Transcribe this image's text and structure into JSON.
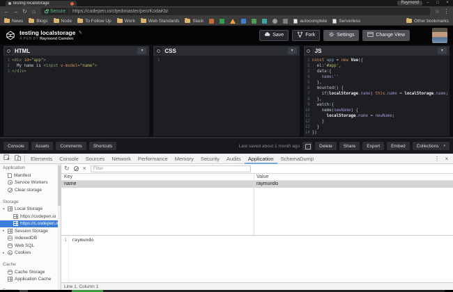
{
  "glyphs": {
    "back": "←",
    "forward": "→",
    "reload": "↻",
    "home": "⌂",
    "star": "☆",
    "kebab": "⋮",
    "minimize": "–",
    "restore": "□",
    "close": "×",
    "pencil": "✎",
    "chevron_down": "▾",
    "refresh": "↻",
    "clear_x": "×",
    "dt_kebab": "⋮",
    "dt_close": "×"
  },
  "browser": {
    "tab_title": "testing localstorage",
    "profile_name": "Raymond",
    "address": {
      "secure_label": "Secure",
      "url": "https://codepen.io/cfjedimaster/pen/KodaKb/"
    },
    "bookmarks": [
      {
        "label": "News",
        "icon": "folder"
      },
      {
        "label": "Blogs",
        "icon": "folder"
      },
      {
        "label": "Node",
        "icon": "folder"
      },
      {
        "label": "To Follow Up",
        "icon": "folder"
      },
      {
        "label": "Work",
        "icon": "folder"
      },
      {
        "label": "Web Standards",
        "icon": "folder"
      },
      {
        "label": "Slack",
        "icon": "folder"
      },
      {
        "icon": "favicon",
        "color": "#c96a38"
      },
      {
        "icon": "favicon",
        "color": "#2e9e4f"
      },
      {
        "icon": "favicon-triangle",
        "color": "#f2a33c"
      },
      {
        "icon": "favicon",
        "color": "#3f7fd4"
      },
      {
        "icon": "favicon",
        "color": "#4b9e57"
      },
      {
        "icon": "favicon",
        "color": "#3aa6a0"
      },
      {
        "icon": "favicon-circle",
        "color": "#9a9a9a"
      },
      {
        "icon": "favicon",
        "color": "#7d7d7d"
      },
      {
        "label": "autocomplete",
        "icon": "page"
      },
      {
        "label": "Serverless",
        "icon": "page"
      }
    ],
    "other_bookmarks_label": "Other bookmarks"
  },
  "pen": {
    "title": "testing localstorage",
    "byline": "A PEN BY",
    "author": "Raymond Camden",
    "buttons": [
      {
        "icon": "cloud",
        "label": "Save"
      },
      {
        "icon": "fork",
        "label": "Fork"
      },
      {
        "icon": "gear",
        "label": "Settings"
      },
      {
        "icon": "layout",
        "label": "Change View"
      }
    ]
  },
  "editors": [
    {
      "label": "HTML",
      "lines": [
        [
          [
            "t",
            "<div "
          ],
          [
            "k",
            "id="
          ],
          [
            "s",
            "\"app\""
          ],
          [
            "t",
            ">"
          ]
        ],
        [
          [
            "p",
            "  My name is "
          ],
          [
            "t",
            "<input "
          ],
          [
            "k",
            "v-model="
          ],
          [
            "s",
            "\"name\""
          ],
          [
            "t",
            ">"
          ]
        ],
        [
          [
            "t",
            "</div>"
          ]
        ]
      ]
    },
    {
      "label": "CSS",
      "lines": [
        []
      ]
    },
    {
      "label": "JS",
      "lines": [
        [
          [
            "k",
            "const "
          ],
          [
            "v",
            "app "
          ],
          [
            "p",
            "= "
          ],
          [
            "k",
            "new "
          ],
          [
            "b",
            "Vue"
          ],
          [
            "p",
            "({"
          ]
        ],
        [
          [
            "p",
            "  el:"
          ],
          [
            "s",
            "'#app'"
          ],
          [
            "p",
            ","
          ]
        ],
        [
          [
            "p",
            "  data:{"
          ]
        ],
        [
          [
            "p",
            "    "
          ],
          [
            "n",
            "name"
          ],
          [
            "p",
            ":"
          ],
          [
            "s",
            "''"
          ]
        ],
        [
          [
            "p",
            "  },"
          ]
        ],
        [
          [
            "p",
            "  mounted() {"
          ]
        ],
        [
          [
            "p",
            "    if("
          ],
          [
            "b",
            "localStorage"
          ],
          [
            "n",
            ".name"
          ],
          [
            "p",
            ") "
          ],
          [
            "k",
            "this"
          ],
          [
            "n",
            ".name"
          ],
          [
            "p",
            " = "
          ],
          [
            "b",
            "localStorage"
          ],
          [
            "n",
            ".name"
          ],
          [
            "p",
            ";"
          ]
        ],
        [
          [
            "p",
            "  },"
          ]
        ],
        [
          [
            "p",
            "  watch:{"
          ]
        ],
        [
          [
            "p",
            "    name("
          ],
          [
            "n",
            "newName"
          ],
          [
            "p",
            ") {"
          ]
        ],
        [
          [
            "p",
            "      "
          ],
          [
            "b",
            "localStorage"
          ],
          [
            "n",
            ".name"
          ],
          [
            "p",
            " = "
          ],
          [
            "n",
            "newName"
          ],
          [
            "p",
            ";"
          ]
        ],
        [
          [
            "p",
            "    }"
          ]
        ],
        [
          [
            "p",
            "  }"
          ]
        ],
        [
          [
            "p",
            "})"
          ]
        ]
      ]
    }
  ],
  "pen_footer": {
    "left_buttons": [
      "Console",
      "Assets",
      "Comments",
      "Shortcuts"
    ],
    "saved_text": "Last saved about 1 month ago",
    "right_buttons": [
      "Delete",
      "Share",
      "Export",
      "Embed"
    ],
    "collections_label": "Collections"
  },
  "devtools": {
    "tabs": [
      "Elements",
      "Console",
      "Sources",
      "Network",
      "Performance",
      "Memory",
      "Security",
      "Audits",
      "Application",
      "SchemaDump"
    ],
    "active_tab": "Application",
    "sidebar": {
      "sections": [
        {
          "title": "Application",
          "items": [
            {
              "label": "Manifest",
              "icon": "page"
            },
            {
              "label": "Service Workers",
              "icon": "gear"
            },
            {
              "label": "Clear storage",
              "icon": "clear"
            }
          ]
        },
        {
          "title": "Storage",
          "items": [
            {
              "label": "Local Storage",
              "icon": "grid",
              "arrow": "▾"
            },
            {
              "label": "https://codepen.io",
              "icon": "grid",
              "child": true
            },
            {
              "label": "https://s.codepen.io",
              "icon": "grid",
              "child": true,
              "selected": true
            },
            {
              "label": "Session Storage",
              "icon": "grid",
              "arrow": "▸"
            },
            {
              "label": "IndexedDB",
              "icon": "db"
            },
            {
              "label": "Web SQL",
              "icon": "db"
            },
            {
              "label": "Cookies",
              "icon": "cookie",
              "arrow": "▸"
            }
          ]
        },
        {
          "title": "Cache",
          "items": [
            {
              "label": "Cache Storage",
              "icon": "db"
            },
            {
              "label": "Application Cache",
              "icon": "grid"
            }
          ]
        },
        {
          "title": "Frames",
          "items": []
        }
      ]
    },
    "storage": {
      "filter_placeholder": "Filter",
      "columns": [
        "Key",
        "Value"
      ],
      "rows": [
        {
          "key": "name",
          "value": "raymundo"
        }
      ],
      "preview": {
        "line": "1",
        "text": "raymundo"
      },
      "status": "Line 1, Column 1"
    }
  },
  "colors": {
    "secure_green": "#5cb583",
    "devtools_tab_accent": "#73a7e0",
    "sidebar_selection_blue": "#3b7dd8",
    "selected_row_gray": "#d4d4d4"
  }
}
